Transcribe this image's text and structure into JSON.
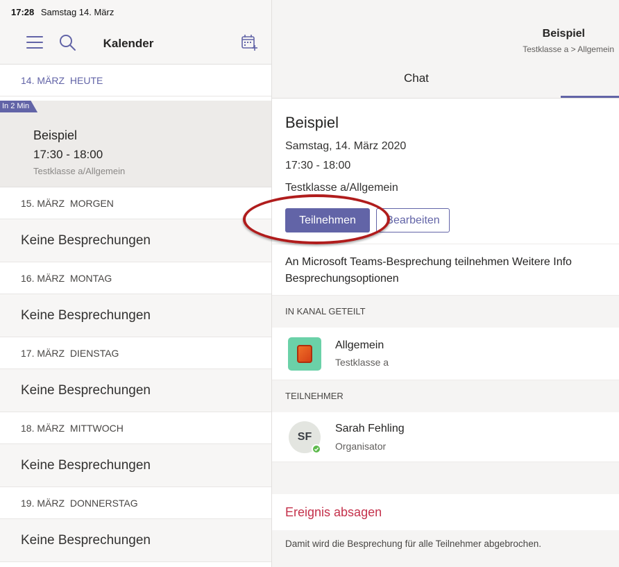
{
  "status_bar": {
    "time": "17:28",
    "date": "Samstag 14. März"
  },
  "calendar": {
    "title": "Kalender",
    "today": {
      "date": "14. MÄRZ",
      "label": "HEUTE"
    },
    "event": {
      "badge": "In 2 Min",
      "title": "Beispiel",
      "time": "17:30 - 18:00",
      "channel": "Testklasse a/Allgemein"
    },
    "days": [
      {
        "date": "15. MÄRZ",
        "weekday": "MORGEN",
        "empty_text": "Keine Besprechungen"
      },
      {
        "date": "16. MÄRZ",
        "weekday": "MONTAG",
        "empty_text": "Keine Besprechungen"
      },
      {
        "date": "17. MÄRZ",
        "weekday": "DIENSTAG",
        "empty_text": "Keine Besprechungen"
      },
      {
        "date": "18. MÄRZ",
        "weekday": "MITTWOCH",
        "empty_text": "Keine Besprechungen"
      },
      {
        "date": "19. MÄRZ",
        "weekday": "DONNERSTAG",
        "empty_text": "Keine Besprechungen"
      }
    ]
  },
  "detail": {
    "header_title": "Beispiel",
    "breadcrumb": "Testklasse a > Allgemein",
    "tab_chat": "Chat",
    "title": "Beispiel",
    "date": "Samstag, 14. März 2020",
    "time": "17:30 - 18:00",
    "channel": "Testklasse a/Allgemein",
    "join_button": "Teilnehmen",
    "edit_button": "Bearbeiten",
    "join_text": "An Microsoft Teams-Besprechung teilnehmen",
    "more_info": "Weitere Info",
    "meeting_options": "Besprechungsoptionen",
    "shared_header": "IN KANAL GETEILT",
    "shared_channel": {
      "name": "Allgemein",
      "team": "Testklasse a"
    },
    "attendees_header": "TEILNEHMER",
    "attendee": {
      "initials": "SF",
      "name": "Sarah Fehling",
      "role": "Organisator"
    },
    "cancel_label": "Ereignis absagen",
    "cancel_hint": "Damit wird die Besprechung für alle Teilnehmer abgebrochen."
  },
  "colors": {
    "accent": "#6264a7",
    "danger": "#c4314b",
    "annotation": "#b01c1c",
    "presence": "#5db94c",
    "channel_tile": "#6bd1a8"
  }
}
